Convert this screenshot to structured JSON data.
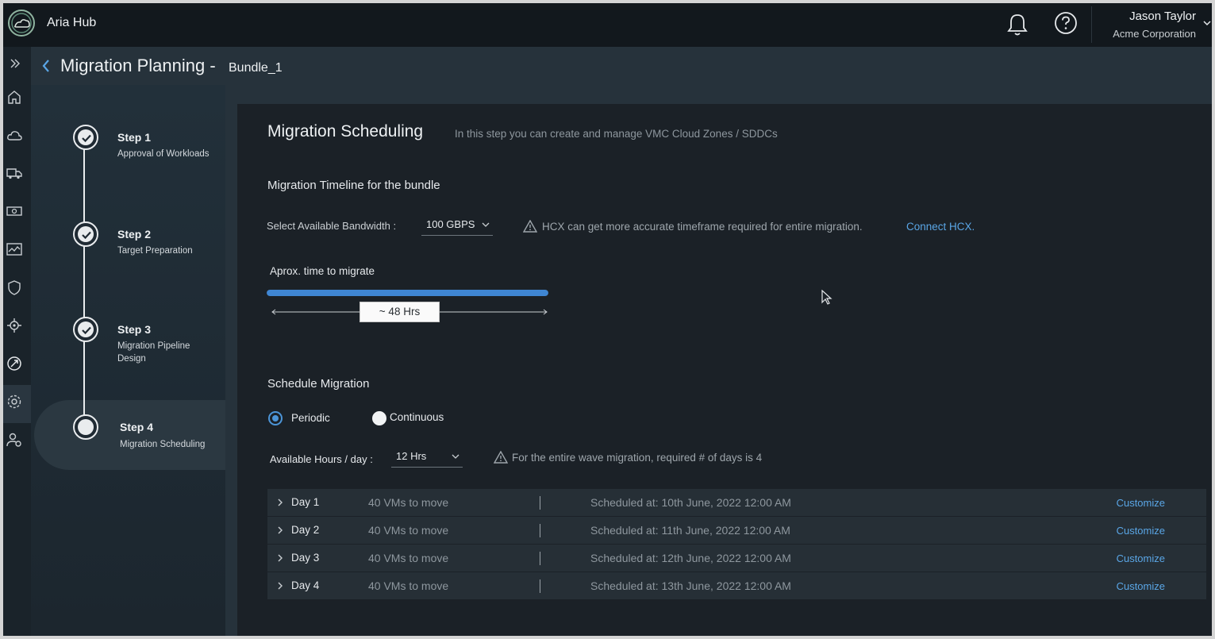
{
  "header": {
    "app_title": "Aria Hub",
    "user_name": "Jason Taylor",
    "user_org": "Acme Corporation"
  },
  "page": {
    "title": "Migration Planning -",
    "subtitle": "Bundle_1"
  },
  "rail": {
    "icons": [
      "expand-icon",
      "home-icon",
      "cloud-icon",
      "truck-icon",
      "cost-icon",
      "chart-icon",
      "shield-icon",
      "target-icon",
      "migration-icon",
      "settings-icon",
      "user-settings-icon"
    ],
    "active": "migration-icon"
  },
  "steps": [
    {
      "title": "Step 1",
      "desc": "Approval of Workloads",
      "state": "complete"
    },
    {
      "title": "Step 2",
      "desc": "Target Preparation",
      "state": "complete"
    },
    {
      "title": "Step 3",
      "desc": "Migration Pipeline Design",
      "state": "complete"
    },
    {
      "title": "Step 4",
      "desc": "Migration Scheduling",
      "state": "active"
    }
  ],
  "section": {
    "title": "Migration Scheduling",
    "hint": "In this step you can create and manage VMC Cloud Zones / SDDCs"
  },
  "timeline": {
    "heading": "Migration Timeline for the bundle",
    "bandwidth_label": "Select Available Bandwidth :",
    "bandwidth_value": "100 GBPS",
    "hcx_warning": "HCX can get more accurate timeframe required for entire migration.",
    "hcx_link": "Connect HCX.",
    "approx_label": "Aprox. time to migrate",
    "progress_percent": 100,
    "duration": "~ 48 Hrs"
  },
  "schedule": {
    "heading": "Schedule Migration",
    "options": {
      "periodic": "Periodic",
      "continuous": "Continuous"
    },
    "selected": "periodic",
    "hours_label": "Available Hours / day :",
    "hours_value": "12 Hrs",
    "days_warning": "For the entire wave migration, required # of days is 4",
    "days": [
      {
        "day": "Day 1",
        "vms": "40 VMs to move",
        "scheduled": "Scheduled at: 10th June, 2022   12:00 AM",
        "action": "Customize"
      },
      {
        "day": "Day 2",
        "vms": "40 VMs to move",
        "scheduled": "Scheduled at: 11th June, 2022   12:00 AM",
        "action": "Customize"
      },
      {
        "day": "Day 3",
        "vms": "40 VMs to move",
        "scheduled": "Scheduled at: 12th June, 2022   12:00 AM",
        "action": "Customize"
      },
      {
        "day": "Day 4",
        "vms": "40 VMs to move",
        "scheduled": "Scheduled at: 13th June, 2022   12:00 AM",
        "action": "Customize"
      }
    ]
  },
  "colors": {
    "accent": "#3f86d3",
    "link": "#5aa6e6",
    "background": "#1b2127"
  }
}
